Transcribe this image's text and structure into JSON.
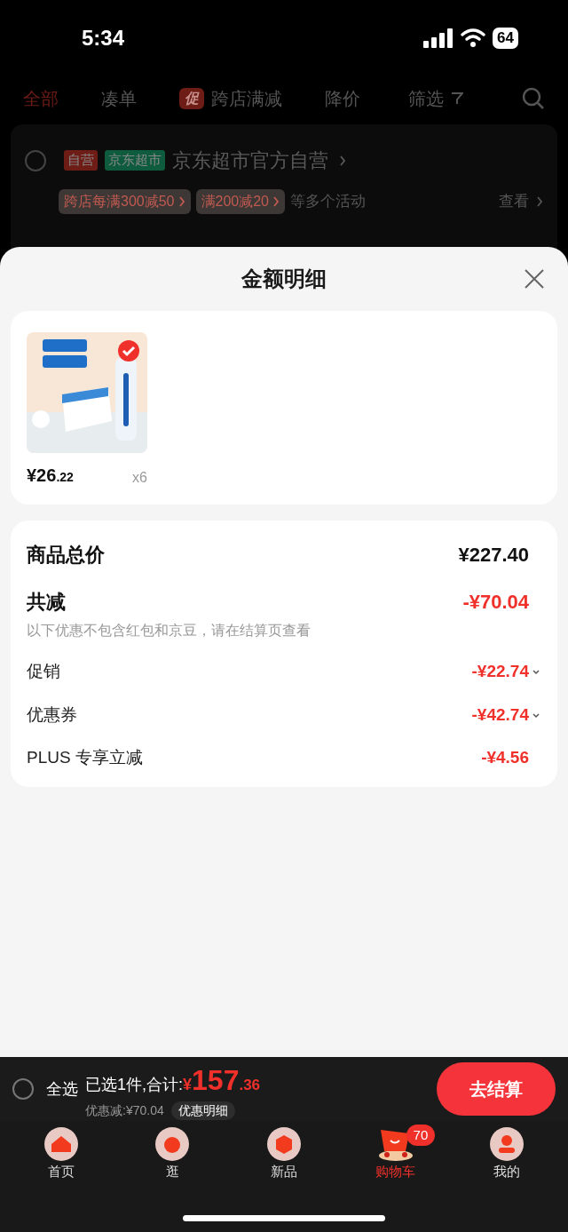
{
  "status_bar": {
    "time": "5:34",
    "battery": "64"
  },
  "tabs": [
    {
      "label": "全部",
      "selected": true
    },
    {
      "label": "凑单",
      "selected": false
    },
    {
      "label": "跨店满减",
      "selected": false,
      "badge": "促"
    },
    {
      "label": "降价",
      "selected": false
    }
  ],
  "filter": {
    "label": "筛选"
  },
  "store": {
    "checked": false,
    "tags": [
      {
        "text": "自营",
        "color": "#6e1c16"
      },
      {
        "text": "京东超市",
        "color": "#0f5b3d"
      }
    ],
    "name": "京东超市官方自营",
    "promos": [
      "跨店每满300减50",
      "满200减20"
    ],
    "promo_more": "等多个活动",
    "view": "查看"
  },
  "sheet": {
    "title": "金额明细",
    "products": [
      {
        "kind": "picture",
        "selected": true,
        "price_int": "¥26",
        "price_dec": ".22",
        "qty": "x6"
      }
    ],
    "rows": [
      {
        "kind": "total",
        "label": "商品总价",
        "value": "¥227.40"
      },
      {
        "kind": "reduction",
        "label": "共减",
        "value": "-¥70.04",
        "note": "以下优惠不包含红包和京豆，请在结算页查看"
      },
      {
        "kind": "detail",
        "label": "促销",
        "value": "-¥22.74",
        "expandable": true
      },
      {
        "kind": "detail",
        "label": "优惠券",
        "value": "-¥42.74",
        "expandable": true
      },
      {
        "kind": "detail",
        "label": "PLUS 专享立减",
        "value": "-¥4.56",
        "expandable": false
      }
    ]
  },
  "checkout_bar": {
    "checked": false,
    "select_all": "全选",
    "summary": "已选1件,合计:",
    "currency": "¥",
    "total_int": "157",
    "total_dec": ".36",
    "discount": "优惠减:¥70.04",
    "detail_button": "优惠明细",
    "checkout": "去结算"
  },
  "nav": [
    {
      "kind": "home",
      "label": "首页",
      "selected": false
    },
    {
      "kind": "explore",
      "label": "逛",
      "selected": false
    },
    {
      "kind": "new",
      "label": "新品",
      "selected": false
    },
    {
      "kind": "cart",
      "label": "购物车",
      "selected": true,
      "badge": "70"
    },
    {
      "kind": "me",
      "label": "我的",
      "selected": false
    }
  ]
}
